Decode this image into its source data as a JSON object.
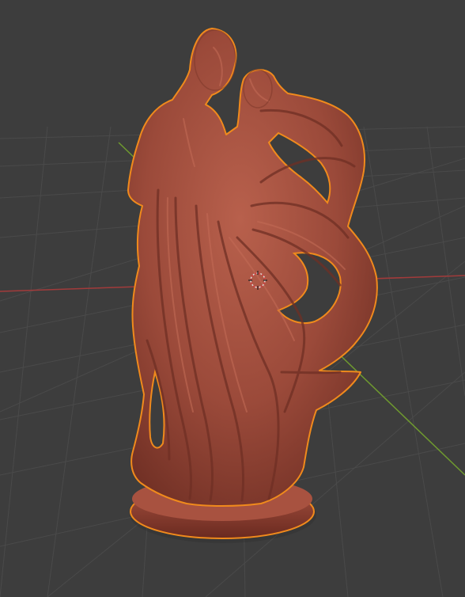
{
  "viewport": {
    "background_color": "#3d3d3d",
    "grid_color": "#4a4a4a",
    "x_axis_color": "#a23b3b",
    "y_axis_color": "#6f9a2f",
    "selection_outline_color": "#f08a1c",
    "material_color": "#9b4a3a",
    "material_shadow_color": "#6f2f24",
    "material_highlight_color": "#b8604c",
    "object_name": "dancing-couple-sculpture",
    "cursor_icon": "3d-cursor-icon"
  }
}
